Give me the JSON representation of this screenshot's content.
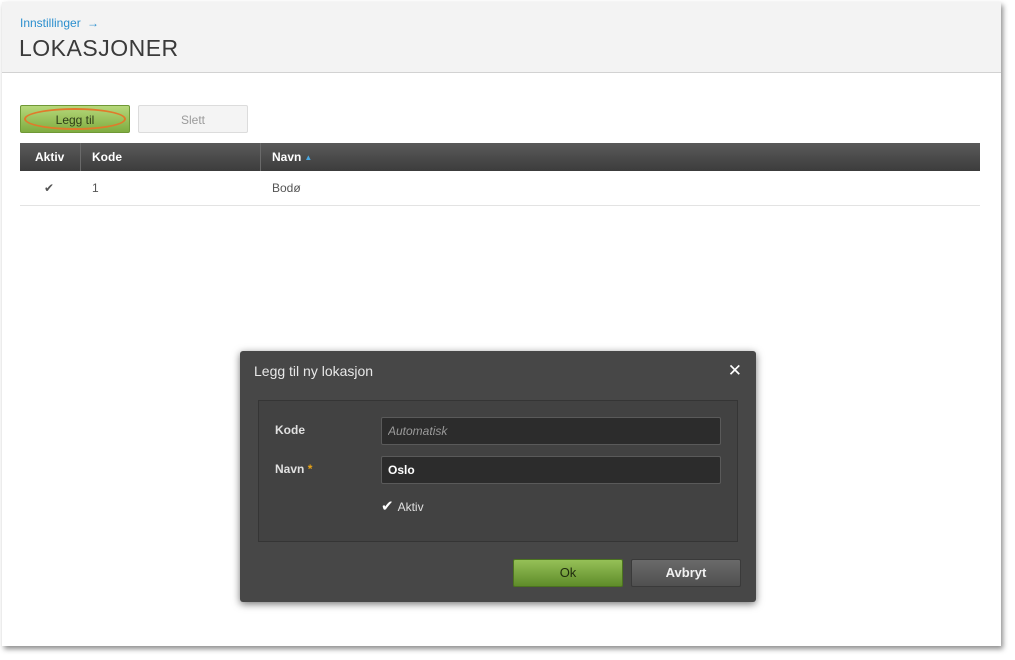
{
  "header": {
    "breadcrumb": "Innstillinger",
    "breadcrumb_arrow": "→",
    "title": "LOKASJONER"
  },
  "toolbar": {
    "add_label": "Legg til",
    "delete_label": "Slett"
  },
  "table": {
    "columns": [
      "Aktiv",
      "Kode",
      "Navn"
    ],
    "sort_indicator": "▲",
    "rows": [
      {
        "aktiv": "✔",
        "kode": "1",
        "navn": "Bodø"
      }
    ]
  },
  "dialog": {
    "title": "Legg til ny lokasjon",
    "close_glyph": "✕",
    "fields": {
      "kode_label": "Kode",
      "kode_placeholder": "Automatisk",
      "navn_label": "Navn",
      "required_mark": "*",
      "navn_value": "Oslo",
      "aktiv_label": "Aktiv",
      "aktiv_checked": "✔"
    },
    "ok_label": "Ok",
    "cancel_label": "Avbryt"
  },
  "colors": {
    "link": "#2b8fce",
    "primary_green": "#7fac40",
    "highlight_ring": "#e07a2b",
    "dialog_bg": "#474747",
    "table_header": "#3c3c3c"
  }
}
